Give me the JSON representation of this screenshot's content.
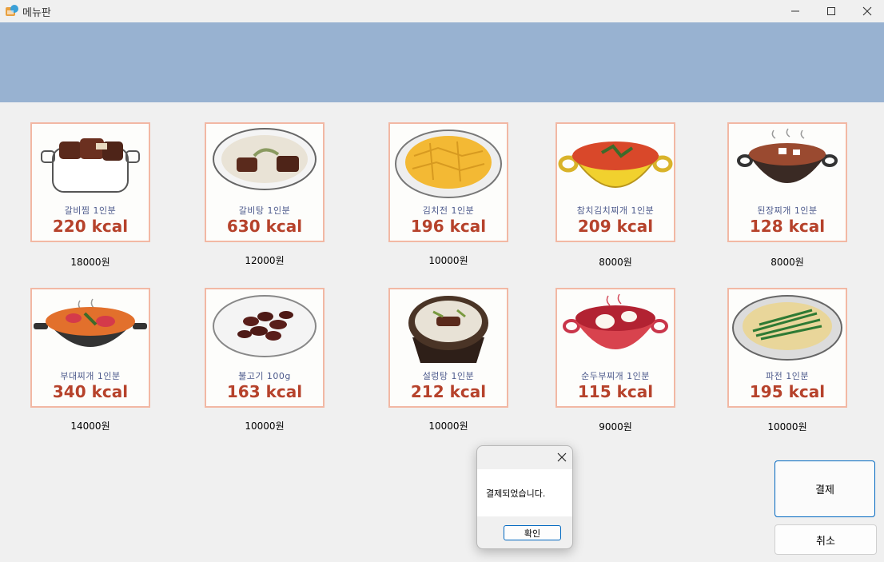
{
  "window": {
    "title": "메뉴판"
  },
  "menu": [
    {
      "name": "갈비찜 1인분",
      "kcal": "220 kcal",
      "price": "18000원",
      "icon": "galbijjim-image"
    },
    {
      "name": "갈비탕 1인분",
      "kcal": "630 kcal",
      "price": "12000원",
      "icon": "galbitang-image"
    },
    {
      "name": "김치전 1인분",
      "kcal": "196 kcal",
      "price": "10000원",
      "icon": "kimchijeon-image"
    },
    {
      "name": "참치김치찌개 1인분",
      "kcal": "209 kcal",
      "price": "8000원",
      "icon": "tuna-kimchi-jjigae-image"
    },
    {
      "name": "된장찌개 1인분",
      "kcal": "128 kcal",
      "price": "8000원",
      "icon": "doenjang-jjigae-image"
    },
    {
      "name": "부대찌개 1인분",
      "kcal": "340 kcal",
      "price": "14000원",
      "icon": "budae-jjigae-image"
    },
    {
      "name": "불고기 100g",
      "kcal": "163 kcal",
      "price": "10000원",
      "icon": "bulgogi-image"
    },
    {
      "name": "설렁탕 1인분",
      "kcal": "212 kcal",
      "price": "10000원",
      "icon": "seolleongtang-image"
    },
    {
      "name": "순두부찌개 1인분",
      "kcal": "115 kcal",
      "price": "9000원",
      "icon": "sundubu-jjigae-image"
    },
    {
      "name": "파전 1인분",
      "kcal": "195 kcal",
      "price": "10000원",
      "icon": "pajeon-image"
    }
  ],
  "buttons": {
    "pay": "결제",
    "cancel": "취소"
  },
  "dialog": {
    "message": "결제되었습니다.",
    "ok": "확인"
  },
  "colors": {
    "banner": "#98b2d1",
    "accent": "#0067c0",
    "kcal": "#b6422b"
  }
}
